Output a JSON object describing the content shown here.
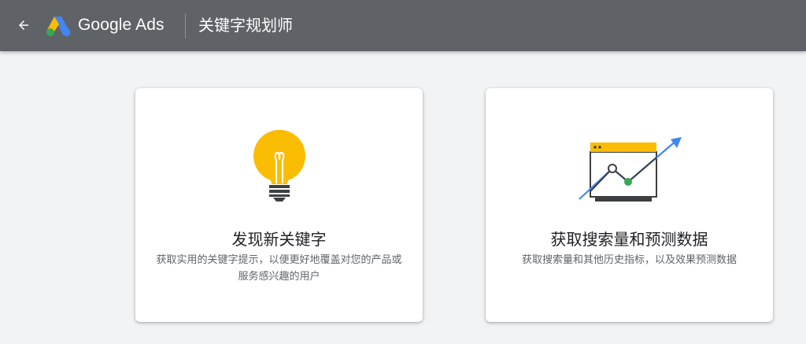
{
  "header": {
    "back_icon": "arrow-back-icon",
    "logo_icon": "google-ads-logo",
    "brand": "Google Ads",
    "tool_title": "关键字规划师"
  },
  "cards": [
    {
      "icon": "lightbulb-illustration",
      "title": "发现新关键字",
      "description": "获取实用的关键字提示，以便更好地覆盖对您的产品或服务感兴趣的用户"
    },
    {
      "icon": "forecast-chart-illustration",
      "title": "获取搜索量和预测数据",
      "description": "获取搜索量和其他历史指标，以及效果预测数据"
    }
  ],
  "colors": {
    "topbar": "#5f6368",
    "background": "#f1f3f4",
    "bulb_yellow": "#fbbc04",
    "arrow_blue": "#4285f4",
    "dot_green": "#34a853"
  }
}
